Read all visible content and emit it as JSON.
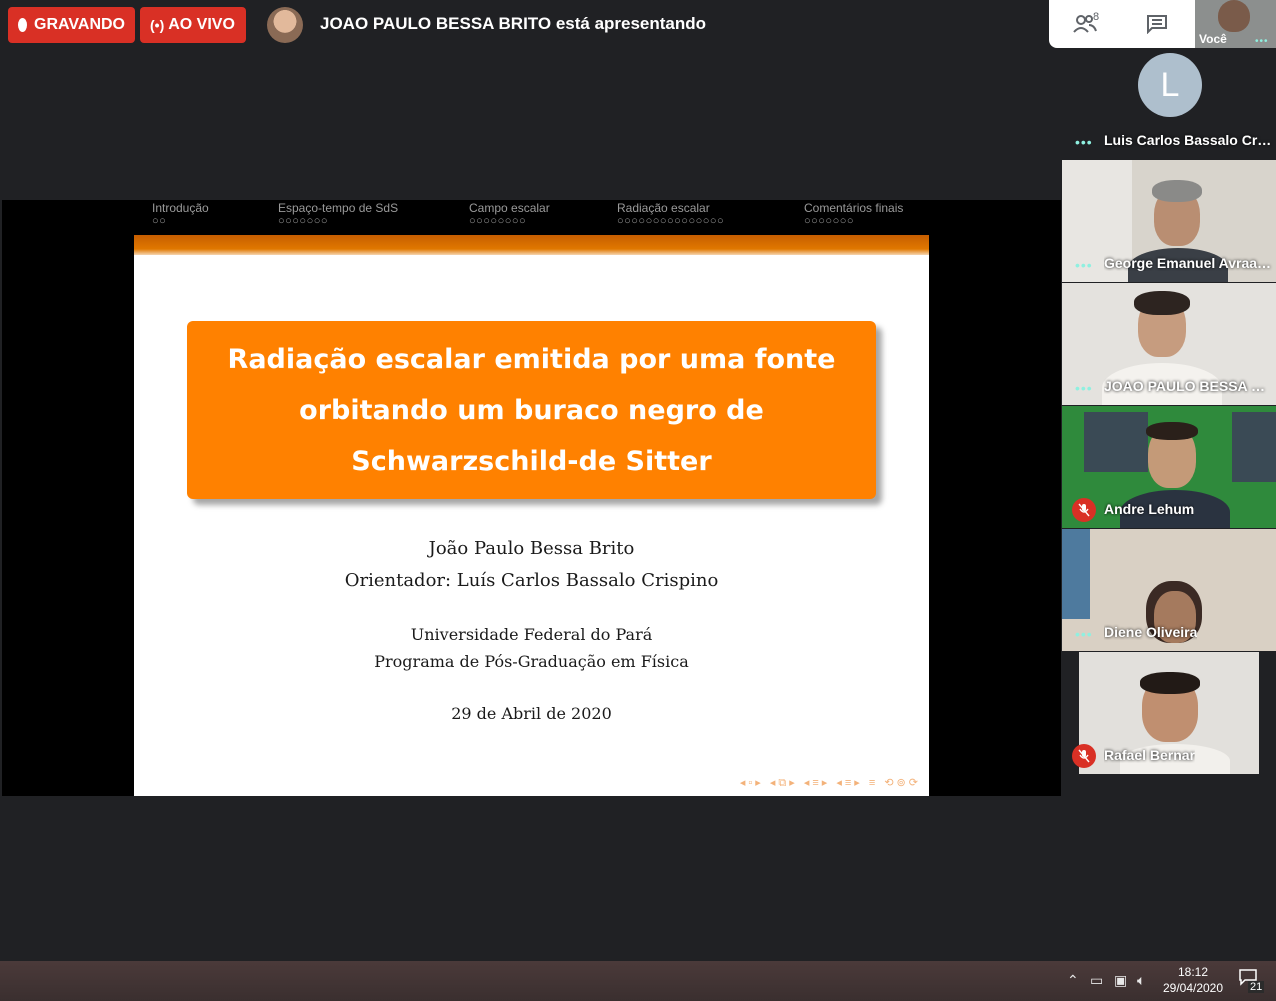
{
  "top_bar": {
    "recording_label": "GRAVANDO",
    "live_label": "AO VIVO",
    "presenter_status": "JOAO PAULO BESSA BRITO está apresentando"
  },
  "controls": {
    "people_count": "8",
    "self_label": "Você"
  },
  "slide": {
    "nav": [
      {
        "label": "Introdução",
        "dots": "○○"
      },
      {
        "label": "Espaço-tempo de SdS",
        "dots": "○○○○○○○"
      },
      {
        "label": "Campo escalar",
        "dots": "○○○○○○○○"
      },
      {
        "label": "Radiação escalar",
        "dots": "○○○○○○○○○○○○○○○"
      },
      {
        "label": "Comentários finais",
        "dots": "○○○○○○○"
      }
    ],
    "title_lines": [
      "Radiação escalar emitida por uma fonte",
      "orbitando um buraco negro de",
      "Schwarzschild-de Sitter"
    ],
    "author": "João Paulo Bessa Brito",
    "advisor": "Orientador: Luís Carlos Bassalo Crispino",
    "university": "Universidade Federal do Pará",
    "program": "Programa de Pós-Graduação em Física",
    "date": "29 de Abril de 2020",
    "accent_color": "#ff8100"
  },
  "participants": [
    {
      "name": "Luis Carlos Bassalo Crispi…",
      "avatar_letter": "L",
      "mic_muted": false
    },
    {
      "name": "George Emanuel Avraam …",
      "mic_muted": false
    },
    {
      "name": "JOAO PAULO BESSA BRITO",
      "mic_muted": false
    },
    {
      "name": "Andre Lehum",
      "mic_muted": true
    },
    {
      "name": "Diene Oliveira",
      "mic_muted": false
    },
    {
      "name": "Rafael Bernar",
      "mic_muted": true
    }
  ],
  "taskbar": {
    "time": "18:12",
    "date": "29/04/2020",
    "notification_count": "21"
  }
}
